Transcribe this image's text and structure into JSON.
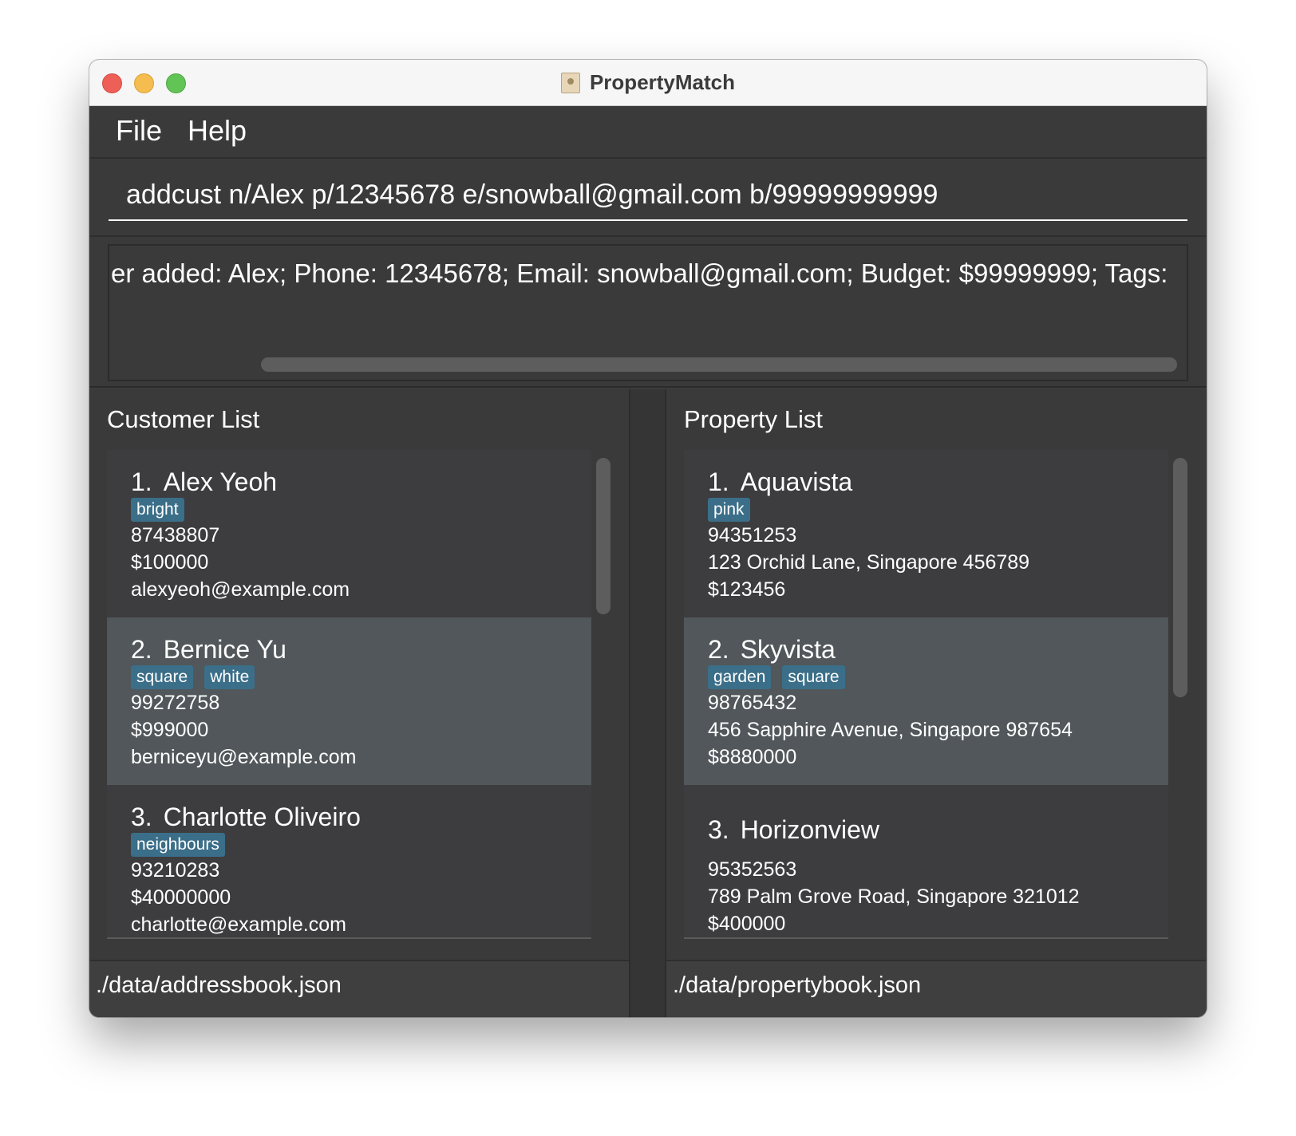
{
  "window": {
    "title": "PropertyMatch",
    "icon": "contact-card-icon"
  },
  "menu": {
    "file": "File",
    "help": "Help"
  },
  "command": {
    "value": "addcust n/Alex p/12345678 e/snowball@gmail.com b/99999999999"
  },
  "result": {
    "text": "er added: Alex; Phone: 12345678; Email: snowball@gmail.com; Budget: $99999999; Tags:"
  },
  "customers": {
    "title": "Customer List",
    "items": [
      {
        "index": "1.",
        "name": "Alex Yeoh",
        "tags": [
          "bright"
        ],
        "phone": "87438807",
        "budget": "$100000",
        "email": "alexyeoh@example.com"
      },
      {
        "index": "2.",
        "name": "Bernice Yu",
        "tags": [
          "square",
          "white"
        ],
        "phone": "99272758",
        "budget": "$999000",
        "email": "berniceyu@example.com"
      },
      {
        "index": "3.",
        "name": "Charlotte Oliveiro",
        "tags": [
          "neighbours"
        ],
        "phone": "93210283",
        "budget": "$40000000",
        "email": "charlotte@example.com"
      }
    ]
  },
  "properties": {
    "title": "Property List",
    "items": [
      {
        "index": "1.",
        "name": "Aquavista",
        "tags": [
          "pink"
        ],
        "phone": "94351253",
        "address": "123 Orchid Lane, Singapore 456789",
        "price": "$123456"
      },
      {
        "index": "2.",
        "name": "Skyvista",
        "tags": [
          "garden",
          "square"
        ],
        "phone": "98765432",
        "address": "456 Sapphire Avenue, Singapore 987654",
        "price": "$8880000"
      },
      {
        "index": "3.",
        "name": "Horizonview",
        "tags": [],
        "phone": "95352563",
        "address": "789 Palm Grove Road, Singapore 321012",
        "price": "$400000"
      }
    ]
  },
  "status": {
    "customer_file": "./data/addressbook.json",
    "property_file": "./data/propertybook.json"
  },
  "colors": {
    "tag": "#3b6e88",
    "selected_row": "#51575a",
    "background": "#3a3a3a"
  }
}
